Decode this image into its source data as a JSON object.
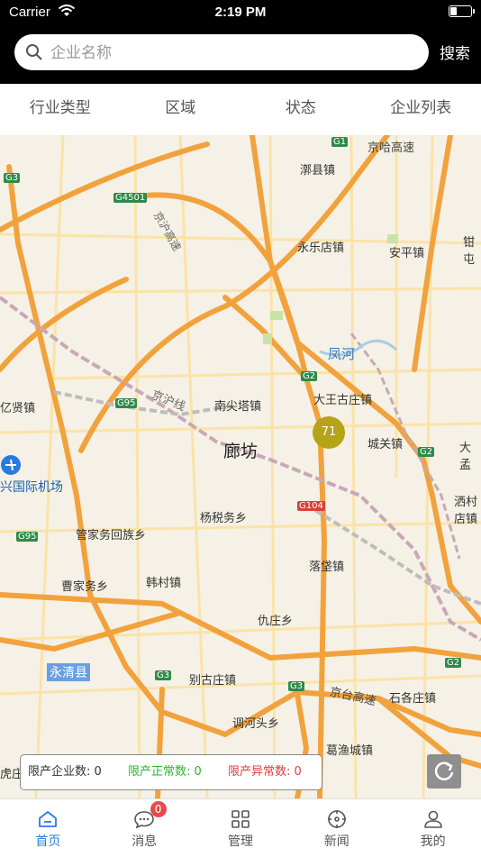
{
  "status_bar": {
    "carrier": "Carrier",
    "time": "2:19 PM"
  },
  "search": {
    "placeholder": "企业名称",
    "button_label": "搜索"
  },
  "filters": [
    {
      "label": "行业类型"
    },
    {
      "label": "区域"
    },
    {
      "label": "状态"
    },
    {
      "label": "企业列表"
    }
  ],
  "map": {
    "cluster_count": "71",
    "places": [
      {
        "name": "漷县镇"
      },
      {
        "name": "永乐店镇"
      },
      {
        "name": "安平镇"
      },
      {
        "name": "钳屯"
      },
      {
        "name": "凤河"
      },
      {
        "name": "大王古庄镇"
      },
      {
        "name": "南尖塔镇"
      },
      {
        "name": "廊坊"
      },
      {
        "name": "城关镇"
      },
      {
        "name": "大孟"
      },
      {
        "name": "兴国际机场"
      },
      {
        "name": "洒村店镇"
      },
      {
        "name": "杨税务乡"
      },
      {
        "name": "管家务回族乡"
      },
      {
        "name": "落垡镇"
      },
      {
        "name": "韩村镇"
      },
      {
        "name": "曹家务乡"
      },
      {
        "name": "仇庄乡"
      },
      {
        "name": "永清县"
      },
      {
        "name": "别古庄镇"
      },
      {
        "name": "石各庄镇"
      },
      {
        "name": "调河头乡"
      },
      {
        "name": "葛渔城镇"
      },
      {
        "name": "虎庄"
      },
      {
        "name": "亿贤镇"
      }
    ],
    "roads": [
      {
        "name": "京哈高速"
      },
      {
        "name": "京沪线"
      },
      {
        "name": "京台高速"
      },
      {
        "name": "京沪高速"
      }
    ],
    "shields": [
      {
        "label": "G1"
      },
      {
        "label": "G3"
      },
      {
        "label": "G4501"
      },
      {
        "label": "G2"
      },
      {
        "label": "G95"
      },
      {
        "label": "G104"
      },
      {
        "label": "G2"
      },
      {
        "label": "G95"
      },
      {
        "label": "G3"
      },
      {
        "label": "G3"
      },
      {
        "label": "G2"
      }
    ]
  },
  "legend": {
    "total": "限产企业数: 0",
    "normal": "限产正常数: 0",
    "abnormal": "限产异常数: 0",
    "colors": {
      "total": "#333333",
      "normal": "#2db52d",
      "abnormal": "#e23b3b"
    }
  },
  "tabs": [
    {
      "label": "首页",
      "icon": "home-icon",
      "active": true
    },
    {
      "label": "消息",
      "icon": "message-icon",
      "badge": "0"
    },
    {
      "label": "管理",
      "icon": "grid-icon"
    },
    {
      "label": "新闻",
      "icon": "compass-icon"
    },
    {
      "label": "我的",
      "icon": "user-icon"
    }
  ],
  "colors": {
    "accent": "#2a7ae2",
    "cluster": "#b5a318",
    "badge": "#e94b4b"
  }
}
